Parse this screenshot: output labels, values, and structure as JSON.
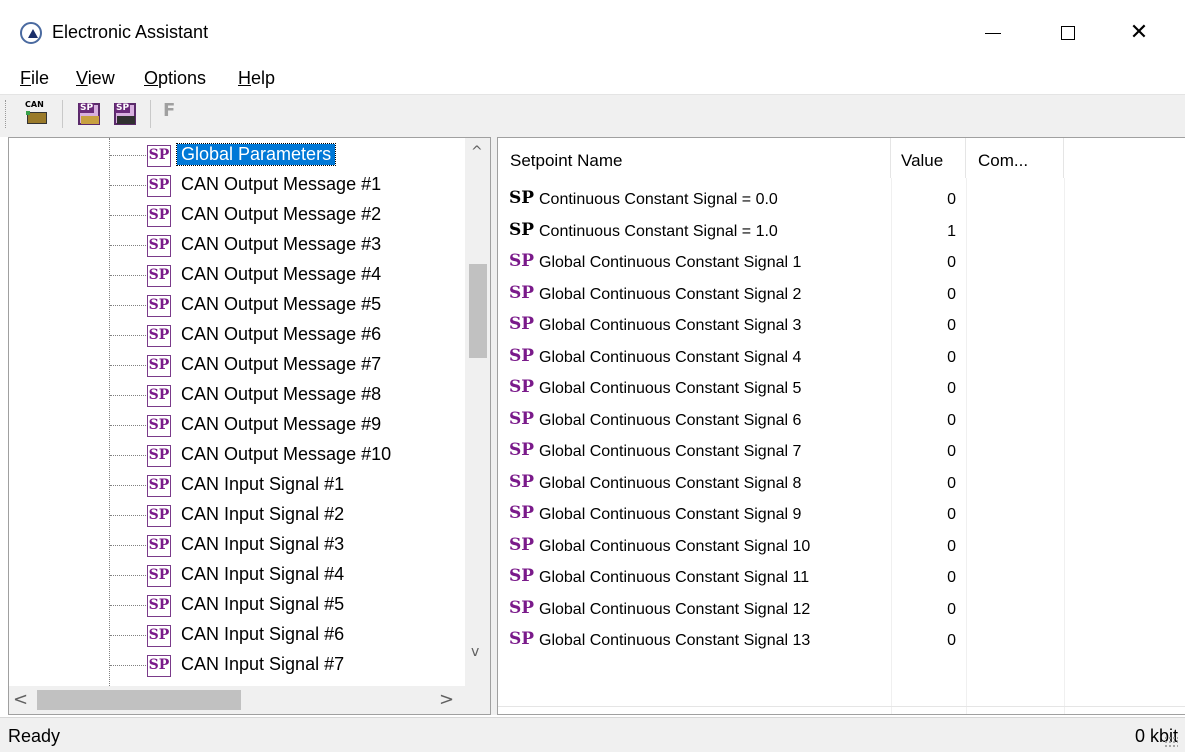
{
  "window": {
    "title": "Electronic Assistant",
    "icon": "app-logo-icon"
  },
  "menu": {
    "file_prefix": "",
    "file_u": "F",
    "file_rest": "ile",
    "view_u": "V",
    "view_rest": "iew",
    "options_u": "O",
    "options_rest": "ptions",
    "help_u": "H",
    "help_rest": "elp"
  },
  "toolbar": {
    "can_label": "CAN",
    "sp_label": "SP",
    "f_label": "F"
  },
  "tree": {
    "items": [
      {
        "label": "Global Parameters",
        "selected": true
      },
      {
        "label": "CAN Output Message #1"
      },
      {
        "label": "CAN Output Message #2"
      },
      {
        "label": "CAN Output Message #3"
      },
      {
        "label": "CAN Output Message #4"
      },
      {
        "label": "CAN Output Message #5"
      },
      {
        "label": "CAN Output Message #6"
      },
      {
        "label": "CAN Output Message #7"
      },
      {
        "label": "CAN Output Message #8"
      },
      {
        "label": "CAN Output Message #9"
      },
      {
        "label": "CAN Output Message #10"
      },
      {
        "label": "CAN Input Signal #1"
      },
      {
        "label": "CAN Input Signal #2"
      },
      {
        "label": "CAN Input Signal #3"
      },
      {
        "label": "CAN Input Signal #4"
      },
      {
        "label": "CAN Input Signal #5"
      },
      {
        "label": "CAN Input Signal #6"
      },
      {
        "label": "CAN Input Signal #7"
      }
    ],
    "icon_label": "SP"
  },
  "list": {
    "columns": {
      "name": "Setpoint Name",
      "value": "Value",
      "comment": "Com..."
    },
    "icon_label": "SP",
    "rows": [
      {
        "name": "Continuous Constant Signal = 0.0",
        "value": "0",
        "icon_color": "black"
      },
      {
        "name": "Continuous Constant Signal = 1.0",
        "value": "1",
        "icon_color": "black"
      },
      {
        "name": "Global Continuous Constant Signal 1",
        "value": "0",
        "icon_color": "purple"
      },
      {
        "name": "Global Continuous Constant Signal 2",
        "value": "0",
        "icon_color": "purple"
      },
      {
        "name": "Global Continuous Constant Signal 3",
        "value": "0",
        "icon_color": "purple"
      },
      {
        "name": "Global Continuous Constant Signal 4",
        "value": "0",
        "icon_color": "purple"
      },
      {
        "name": "Global Continuous Constant Signal 5",
        "value": "0",
        "icon_color": "purple"
      },
      {
        "name": "Global Continuous Constant Signal 6",
        "value": "0",
        "icon_color": "purple"
      },
      {
        "name": "Global Continuous Constant Signal 7",
        "value": "0",
        "icon_color": "purple"
      },
      {
        "name": "Global Continuous Constant Signal 8",
        "value": "0",
        "icon_color": "purple"
      },
      {
        "name": "Global Continuous Constant Signal 9",
        "value": "0",
        "icon_color": "purple"
      },
      {
        "name": "Global Continuous Constant Signal 10",
        "value": "0",
        "icon_color": "purple"
      },
      {
        "name": "Global Continuous Constant Signal 11",
        "value": "0",
        "icon_color": "purple"
      },
      {
        "name": "Global Continuous Constant Signal 12",
        "value": "0",
        "icon_color": "purple"
      },
      {
        "name": "Global Continuous Constant Signal 13",
        "value": "0",
        "icon_color": "purple"
      }
    ]
  },
  "status": {
    "text": "Ready",
    "rate": "0 kbit"
  },
  "colors": {
    "selection": "#0078d7",
    "sp_purple": "#7a1a8a"
  }
}
